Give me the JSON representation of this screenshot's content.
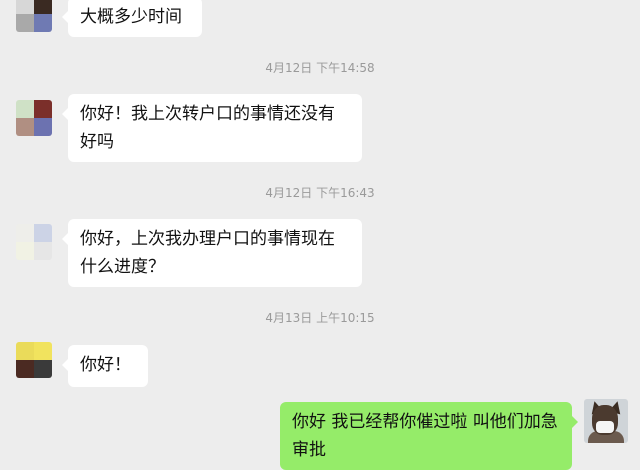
{
  "messages": [
    {
      "side": "left",
      "text": "大概多少时间",
      "avatar": "blurred-avatar-1",
      "avatar_colors": [
        "#d7d7d7",
        "#3a2a22",
        "#a9a9a9",
        "#6f7ab3"
      ]
    },
    {
      "timestamp": "4月12日 下午14:58"
    },
    {
      "side": "left",
      "text": "你好！我上次转户口的事情还没有好吗",
      "avatar": "blurred-avatar-2",
      "avatar_colors": [
        "#cfe1c6",
        "#7b2f2a",
        "#b08f82",
        "#6c72b0"
      ]
    },
    {
      "timestamp": "4月12日 下午16:43"
    },
    {
      "side": "left",
      "text": "你好，上次我办理户口的事情现在什么进度？",
      "avatar": "blurred-avatar-3",
      "avatar_colors": [
        "#eeeeea",
        "#ccd3e6",
        "#f1f2e4",
        "#e6e6e6"
      ]
    },
    {
      "timestamp": "4月13日 上午10:15"
    },
    {
      "side": "left",
      "text": "你好！",
      "avatar": "blurred-avatar-4",
      "avatar_colors": [
        "#eadb5a",
        "#f1e35e",
        "#4b2a22",
        "#3a3a3a"
      ]
    },
    {
      "side": "right",
      "text": "你好 我已经帮你催过啦 叫他们加急审批",
      "avatar": "dog-avatar"
    }
  ]
}
